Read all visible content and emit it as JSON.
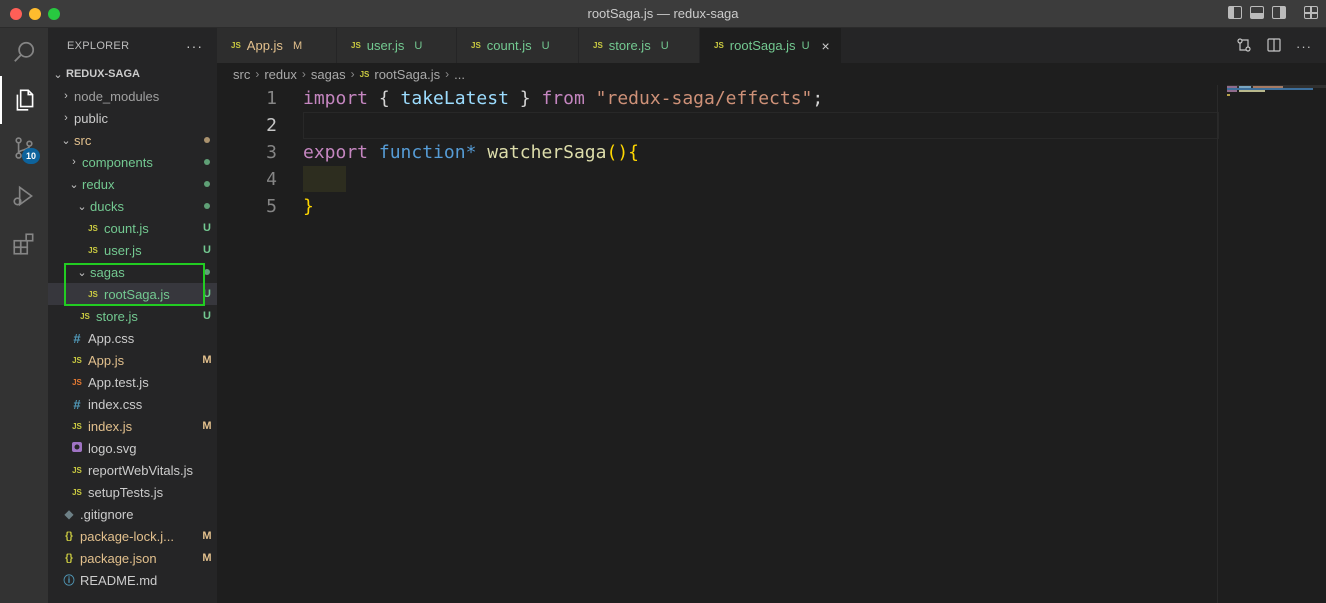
{
  "window": {
    "title": "rootSaga.js — redux-saga"
  },
  "activity": {
    "scm_badge": "10"
  },
  "sidebar": {
    "header": "EXPLORER",
    "more": "···",
    "root": "REDUX-SAGA",
    "items": [
      {
        "label": "node_modules",
        "chevron": "›",
        "status": ""
      },
      {
        "label": "public",
        "chevron": "›",
        "status": ""
      },
      {
        "label": "src",
        "chevron": "⌄",
        "status": ""
      },
      {
        "label": "components",
        "chevron": "›",
        "status": ""
      },
      {
        "label": "redux",
        "chevron": "⌄",
        "status": ""
      },
      {
        "label": "ducks",
        "chevron": "⌄",
        "status": ""
      },
      {
        "label": "count.js",
        "icon": "JS",
        "status": "U"
      },
      {
        "label": "user.js",
        "icon": "JS",
        "status": "U"
      },
      {
        "label": "sagas",
        "chevron": "⌄",
        "status": ""
      },
      {
        "label": "rootSaga.js",
        "icon": "JS",
        "status": "U"
      },
      {
        "label": "store.js",
        "icon": "JS",
        "status": "U"
      },
      {
        "label": "App.css",
        "icon": "#",
        "status": ""
      },
      {
        "label": "App.js",
        "icon": "JS",
        "status": "M"
      },
      {
        "label": "App.test.js",
        "icon": "JS",
        "status": ""
      },
      {
        "label": "index.css",
        "icon": "#",
        "status": ""
      },
      {
        "label": "index.js",
        "icon": "JS",
        "status": "M"
      },
      {
        "label": "logo.svg",
        "icon": "svg-icon",
        "status": ""
      },
      {
        "label": "reportWebVitals.js",
        "icon": "JS",
        "status": ""
      },
      {
        "label": "setupTests.js",
        "icon": "JS",
        "status": ""
      },
      {
        "label": ".gitignore",
        "icon": "◆",
        "status": ""
      },
      {
        "label": "package-lock.j...",
        "icon": "{}",
        "status": "M"
      },
      {
        "label": "package.json",
        "icon": "{}",
        "status": "M"
      },
      {
        "label": "README.md",
        "icon": "ⓘ",
        "status": ""
      }
    ]
  },
  "tabs": [
    {
      "icon": "JS",
      "name": "App.js",
      "status": "M"
    },
    {
      "icon": "JS",
      "name": "user.js",
      "status": "U"
    },
    {
      "icon": "JS",
      "name": "count.js",
      "status": "U"
    },
    {
      "icon": "JS",
      "name": "store.js",
      "status": "U"
    },
    {
      "icon": "JS",
      "name": "rootSaga.js",
      "status": "U",
      "close": "×"
    }
  ],
  "breadcrumb": [
    "src",
    "redux",
    "sagas",
    "rootSaga.js",
    "..."
  ],
  "breadcrumb_sep": "›",
  "editor": {
    "lines": [
      {
        "n": "1",
        "t": [
          "import",
          " { ",
          "takeLatest",
          " } ",
          "from",
          " ",
          "\"redux-saga/effects\"",
          ";"
        ]
      },
      {
        "n": "2",
        "t": []
      },
      {
        "n": "3",
        "t": [
          "export",
          " ",
          "function",
          "*",
          " ",
          "watcherSaga",
          "(",
          ")",
          "{"
        ]
      },
      {
        "n": "4",
        "t": []
      },
      {
        "n": "5",
        "t": [
          "}"
        ]
      }
    ]
  },
  "colors": {
    "accent_modified": "#e2c08d",
    "accent_untracked": "#73c991",
    "highlight_box": "#22cc22"
  }
}
